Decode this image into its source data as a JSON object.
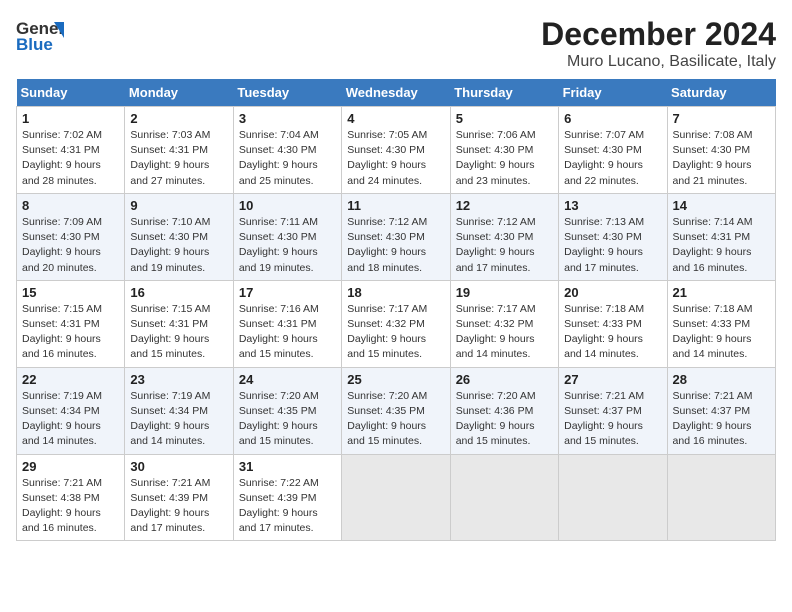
{
  "header": {
    "title": "December 2024",
    "subtitle": "Muro Lucano, Basilicate, Italy",
    "logo_line1": "General",
    "logo_line2": "Blue"
  },
  "days_of_week": [
    "Sunday",
    "Monday",
    "Tuesday",
    "Wednesday",
    "Thursday",
    "Friday",
    "Saturday"
  ],
  "weeks": [
    [
      {
        "day": 1,
        "sunrise": "7:02 AM",
        "sunset": "4:31 PM",
        "daylight": "9 hours and 28 minutes."
      },
      {
        "day": 2,
        "sunrise": "7:03 AM",
        "sunset": "4:31 PM",
        "daylight": "9 hours and 27 minutes."
      },
      {
        "day": 3,
        "sunrise": "7:04 AM",
        "sunset": "4:30 PM",
        "daylight": "9 hours and 25 minutes."
      },
      {
        "day": 4,
        "sunrise": "7:05 AM",
        "sunset": "4:30 PM",
        "daylight": "9 hours and 24 minutes."
      },
      {
        "day": 5,
        "sunrise": "7:06 AM",
        "sunset": "4:30 PM",
        "daylight": "9 hours and 23 minutes."
      },
      {
        "day": 6,
        "sunrise": "7:07 AM",
        "sunset": "4:30 PM",
        "daylight": "9 hours and 22 minutes."
      },
      {
        "day": 7,
        "sunrise": "7:08 AM",
        "sunset": "4:30 PM",
        "daylight": "9 hours and 21 minutes."
      }
    ],
    [
      {
        "day": 8,
        "sunrise": "7:09 AM",
        "sunset": "4:30 PM",
        "daylight": "9 hours and 20 minutes."
      },
      {
        "day": 9,
        "sunrise": "7:10 AM",
        "sunset": "4:30 PM",
        "daylight": "9 hours and 19 minutes."
      },
      {
        "day": 10,
        "sunrise": "7:11 AM",
        "sunset": "4:30 PM",
        "daylight": "9 hours and 19 minutes."
      },
      {
        "day": 11,
        "sunrise": "7:12 AM",
        "sunset": "4:30 PM",
        "daylight": "9 hours and 18 minutes."
      },
      {
        "day": 12,
        "sunrise": "7:12 AM",
        "sunset": "4:30 PM",
        "daylight": "9 hours and 17 minutes."
      },
      {
        "day": 13,
        "sunrise": "7:13 AM",
        "sunset": "4:30 PM",
        "daylight": "9 hours and 17 minutes."
      },
      {
        "day": 14,
        "sunrise": "7:14 AM",
        "sunset": "4:31 PM",
        "daylight": "9 hours and 16 minutes."
      }
    ],
    [
      {
        "day": 15,
        "sunrise": "7:15 AM",
        "sunset": "4:31 PM",
        "daylight": "9 hours and 16 minutes."
      },
      {
        "day": 16,
        "sunrise": "7:15 AM",
        "sunset": "4:31 PM",
        "daylight": "9 hours and 15 minutes."
      },
      {
        "day": 17,
        "sunrise": "7:16 AM",
        "sunset": "4:31 PM",
        "daylight": "9 hours and 15 minutes."
      },
      {
        "day": 18,
        "sunrise": "7:17 AM",
        "sunset": "4:32 PM",
        "daylight": "9 hours and 15 minutes."
      },
      {
        "day": 19,
        "sunrise": "7:17 AM",
        "sunset": "4:32 PM",
        "daylight": "9 hours and 14 minutes."
      },
      {
        "day": 20,
        "sunrise": "7:18 AM",
        "sunset": "4:33 PM",
        "daylight": "9 hours and 14 minutes."
      },
      {
        "day": 21,
        "sunrise": "7:18 AM",
        "sunset": "4:33 PM",
        "daylight": "9 hours and 14 minutes."
      }
    ],
    [
      {
        "day": 22,
        "sunrise": "7:19 AM",
        "sunset": "4:34 PM",
        "daylight": "9 hours and 14 minutes."
      },
      {
        "day": 23,
        "sunrise": "7:19 AM",
        "sunset": "4:34 PM",
        "daylight": "9 hours and 14 minutes."
      },
      {
        "day": 24,
        "sunrise": "7:20 AM",
        "sunset": "4:35 PM",
        "daylight": "9 hours and 15 minutes."
      },
      {
        "day": 25,
        "sunrise": "7:20 AM",
        "sunset": "4:35 PM",
        "daylight": "9 hours and 15 minutes."
      },
      {
        "day": 26,
        "sunrise": "7:20 AM",
        "sunset": "4:36 PM",
        "daylight": "9 hours and 15 minutes."
      },
      {
        "day": 27,
        "sunrise": "7:21 AM",
        "sunset": "4:37 PM",
        "daylight": "9 hours and 15 minutes."
      },
      {
        "day": 28,
        "sunrise": "7:21 AM",
        "sunset": "4:37 PM",
        "daylight": "9 hours and 16 minutes."
      }
    ],
    [
      {
        "day": 29,
        "sunrise": "7:21 AM",
        "sunset": "4:38 PM",
        "daylight": "9 hours and 16 minutes."
      },
      {
        "day": 30,
        "sunrise": "7:21 AM",
        "sunset": "4:39 PM",
        "daylight": "9 hours and 17 minutes."
      },
      {
        "day": 31,
        "sunrise": "7:22 AM",
        "sunset": "4:39 PM",
        "daylight": "9 hours and 17 minutes."
      },
      null,
      null,
      null,
      null
    ]
  ],
  "labels": {
    "sunrise": "Sunrise:",
    "sunset": "Sunset:",
    "daylight": "Daylight:"
  }
}
